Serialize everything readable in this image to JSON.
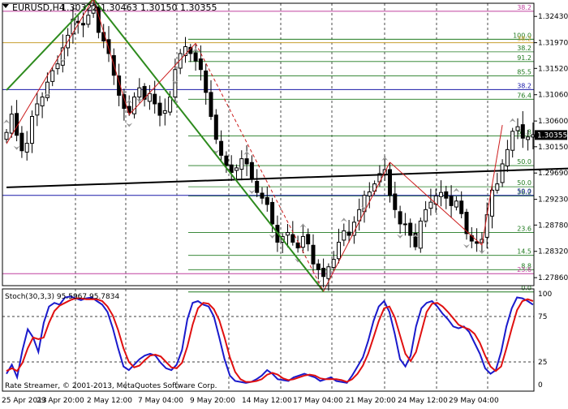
{
  "header": {
    "symbol_tf": "EURUSD,H4",
    "ohlc": "1.30322 1.30463 1.30150 1.30355"
  },
  "footer": {
    "copyright": "Rate Streamer, © 2001-2013, MetaQuotes Software Corp."
  },
  "colors": {
    "background": "#ffffff",
    "candle": "#000000",
    "grid": "#000000",
    "fib_green": "#1f7a1f",
    "pink_level": "#c0409f",
    "blue_level": "#1a1aa8",
    "gold_level": "#c8a030",
    "trend_green": "#2e8b1e",
    "zigzag_red": "#cc1b1b",
    "stoch_main": "#1a1acc",
    "stoch_signal": "#e01010",
    "fractal_grey": "#9a9a9a"
  },
  "chart_data": [
    {
      "type": "candlestick",
      "name": "EURUSD,H4",
      "price_axis": {
        "ylim": [
          1.2772,
          1.3266
        ],
        "tick_labels": [
          "1.32430",
          "1.31970",
          "1.31520",
          "1.31060",
          "1.30600",
          "1.30150",
          "1.29690",
          "1.29230",
          "1.28780",
          "1.28320",
          "1.27860"
        ]
      },
      "current_price": "1.30355",
      "time_axis_labels": [
        "25 Apr 2013",
        "29 Apr 20:00",
        "2 May 12:00",
        "7 May 04:00",
        "9 May 20:00",
        "14 May 12:00",
        "17 May 04:00",
        "21 May 20:00",
        "24 May 12:00",
        "29 May 04:00"
      ],
      "fib_levels_right": [
        {
          "label": "100.0",
          "price": 1.3203
        },
        {
          "label": "91.2",
          "price": 1.3164
        },
        {
          "label": "85.5",
          "price": 1.3139
        },
        {
          "label": "76.4",
          "price": 1.3098
        },
        {
          "label": "61.8",
          "price": 1.3034
        },
        {
          "label": "50.0",
          "price": 1.2982
        },
        {
          "label": "38.2",
          "price": 1.2929
        },
        {
          "label": "23.6",
          "price": 1.2865
        },
        {
          "label": "14.5",
          "price": 1.2825
        },
        {
          "label": "8.8",
          "price": 1.28
        },
        {
          "label": "0.0",
          "price": 1.2761
        }
      ],
      "fib_levels_left": [
        {
          "label": "38.2",
          "price": 1.3181
        },
        {
          "label": "50.0",
          "price": 1.2945
        }
      ],
      "pink_levels": [
        {
          "label": "38.2",
          "price": 1.3252
        },
        {
          "label": "23.6",
          "price": 1.2793
        }
      ],
      "gold_level": {
        "label": "38.2",
        "price": 1.3197
      },
      "blue_levels": [
        {
          "label": "38.2",
          "price": 1.3115
        },
        {
          "label": "50.0",
          "price": 1.293
        }
      ],
      "trendlines": [
        {
          "color": "black",
          "points": [
            [
              0,
              1.2944
            ],
            [
              110,
              1.2977
            ]
          ]
        },
        {
          "color": "green",
          "points": [
            [
              0,
              1.3114
            ],
            [
              17,
              1.3274
            ],
            [
              62,
              1.2762
            ]
          ]
        }
      ],
      "zigzag": [
        [
          0,
          1.302
        ],
        [
          17,
          1.3274
        ],
        [
          24,
          1.3071
        ],
        [
          37,
          1.3196
        ],
        [
          62,
          1.2762
        ],
        [
          75,
          1.2988
        ],
        [
          93,
          1.2843
        ],
        [
          97,
          1.3053
        ]
      ],
      "closes": [
        1.304,
        1.3072,
        1.3035,
        1.3008,
        1.3021,
        1.3068,
        1.309,
        1.3102,
        1.3128,
        1.3148,
        1.316,
        1.3188,
        1.321,
        1.3238,
        1.3232,
        1.3228,
        1.3245,
        1.3262,
        1.3215,
        1.32,
        1.3178,
        1.314,
        1.3105,
        1.3082,
        1.3075,
        1.3102,
        1.3118,
        1.3098,
        1.3108,
        1.309,
        1.307,
        1.3078,
        1.3102,
        1.315,
        1.3178,
        1.319,
        1.3178,
        1.3165,
        1.315,
        1.311,
        1.3068,
        1.3028,
        1.3,
        1.2982,
        1.297,
        1.2978,
        1.2994,
        1.2985,
        1.2958,
        1.2935,
        1.2925,
        1.2914,
        1.288,
        1.2848,
        1.2858,
        1.2865,
        1.2848,
        1.2838,
        1.2858,
        1.2845,
        1.281,
        1.28,
        1.2788,
        1.2805,
        1.2818,
        1.2848,
        1.2868,
        1.286,
        1.2883,
        1.2905,
        1.293,
        1.2936,
        1.295,
        1.2968,
        1.2975,
        1.293,
        1.2905,
        1.288,
        1.288,
        1.286,
        1.284,
        1.2885,
        1.2905,
        1.2918,
        1.2929,
        1.2935,
        1.2925,
        1.2912,
        1.292,
        1.2898,
        1.2863,
        1.285,
        1.2846,
        1.2853,
        1.2896,
        1.2939,
        1.295,
        1.2985,
        1.301,
        1.3042,
        1.305,
        1.303,
        1.3032,
        1.3036
      ]
    },
    {
      "type": "line",
      "name": "Stoch(30,3,3)",
      "legend": "Stoch(30,3,3) 95.5967 95.7834",
      "ylim": [
        0,
        100
      ],
      "levels": [
        100,
        75,
        25,
        0
      ],
      "series": [
        {
          "name": "main",
          "color": "#1a1acc",
          "values": [
            12,
            22,
            8,
            38,
            61,
            52,
            36,
            68,
            86,
            90,
            88,
            96,
            97,
            95,
            93,
            95,
            96,
            92,
            88,
            80,
            62,
            40,
            20,
            16,
            22,
            28,
            32,
            34,
            32,
            24,
            18,
            16,
            22,
            38,
            72,
            90,
            92,
            88,
            86,
            75,
            52,
            28,
            10,
            4,
            3,
            2,
            3,
            6,
            10,
            16,
            12,
            6,
            5,
            4,
            8,
            10,
            12,
            10,
            8,
            4,
            6,
            8,
            4,
            3,
            2,
            10,
            20,
            30,
            48,
            70,
            86,
            92,
            80,
            56,
            28,
            20,
            32,
            64,
            84,
            90,
            92,
            86,
            78,
            72,
            64,
            62,
            64,
            58,
            46,
            34,
            18,
            12,
            16,
            36,
            64,
            84,
            96,
            95,
            92,
            88
          ]
        },
        {
          "name": "signal",
          "color": "#e01010",
          "values": [
            15,
            18,
            15,
            24,
            40,
            52,
            50,
            52,
            68,
            81,
            87,
            90,
            93,
            95,
            95,
            94,
            94,
            94,
            92,
            86,
            76,
            60,
            40,
            25,
            19,
            21,
            27,
            32,
            33,
            31,
            25,
            19,
            18,
            24,
            42,
            66,
            84,
            90,
            89,
            83,
            71,
            52,
            30,
            14,
            6,
            3,
            3,
            4,
            6,
            11,
            13,
            11,
            7,
            5,
            6,
            8,
            10,
            11,
            10,
            7,
            6,
            6,
            6,
            5,
            3,
            6,
            12,
            21,
            34,
            52,
            70,
            84,
            86,
            74,
            54,
            34,
            26,
            36,
            58,
            80,
            89,
            90,
            86,
            80,
            73,
            66,
            63,
            61,
            56,
            46,
            32,
            20,
            15,
            20,
            40,
            62,
            82,
            92,
            94,
            92
          ]
        }
      ]
    }
  ]
}
